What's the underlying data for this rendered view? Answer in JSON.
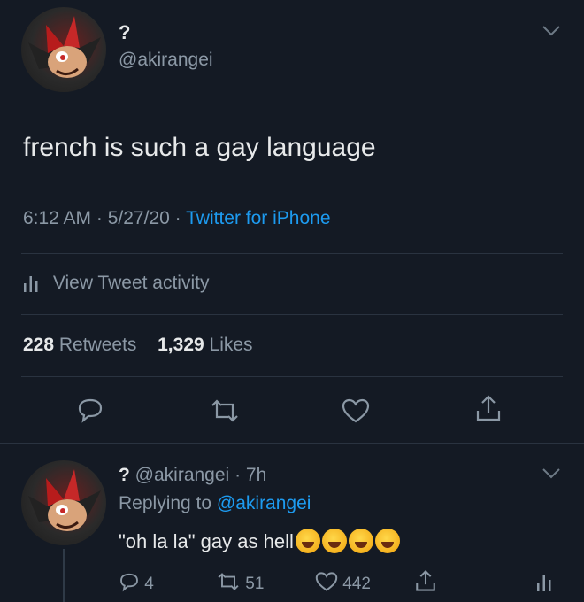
{
  "tweet": {
    "display_name": "?",
    "handle": "@akirangei",
    "text": "french is such a gay language",
    "time": "6:12 AM",
    "date": "5/27/20",
    "source": "Twitter for iPhone",
    "activity_label": "View Tweet activity",
    "retweets_count": "228",
    "retweets_label": "Retweets",
    "likes_count": "1,329",
    "likes_label": "Likes"
  },
  "reply": {
    "display_name": "?",
    "handle": "@akirangei",
    "time_ago": "7h",
    "replying_to_label": "Replying to",
    "replying_to_handle": "@akirangei",
    "text": "\"oh la la\" gay as hell",
    "emojis": [
      "crying-laughing",
      "crying-laughing",
      "rofl",
      "rofl"
    ],
    "reply_count": "4",
    "retweet_count": "51",
    "like_count": "442"
  },
  "icons": {
    "chevron": "chevron-down-icon",
    "reply": "reply-icon",
    "retweet": "retweet-icon",
    "like": "heart-icon",
    "share": "share-icon",
    "analytics": "analytics-icon"
  },
  "colors": {
    "background": "#141a24",
    "text": "#e7e9ea",
    "muted": "#8b98a5",
    "accent": "#1d9bf0"
  }
}
